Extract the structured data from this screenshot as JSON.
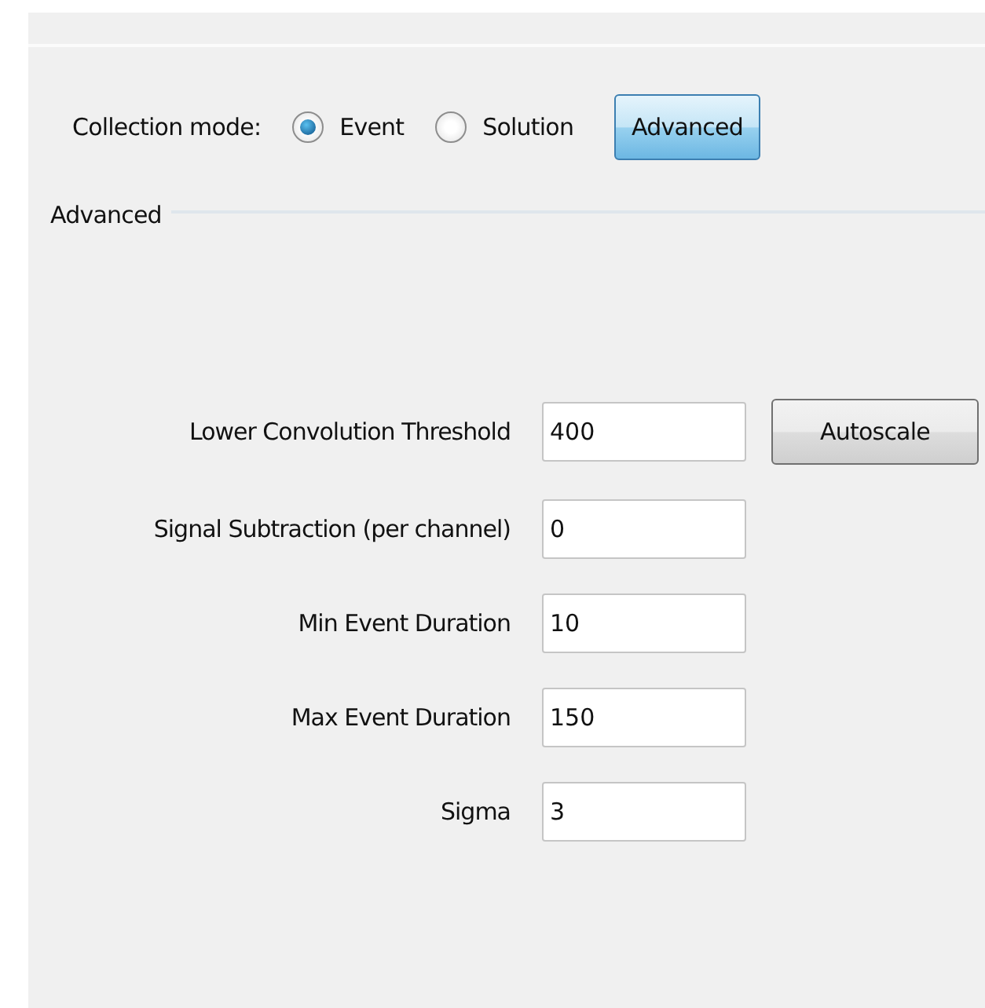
{
  "collection_mode": {
    "label": "Collection mode:",
    "options": [
      {
        "label": "Event",
        "selected": true
      },
      {
        "label": "Solution",
        "selected": false
      }
    ],
    "button": "Advanced"
  },
  "group": {
    "title": "Advanced"
  },
  "fields": [
    {
      "label": "Lower Convolution Threshold",
      "value": "400",
      "button": "Autoscale"
    },
    {
      "label": "Signal Subtraction (per channel)",
      "value": "0"
    },
    {
      "label": "Min Event Duration",
      "value": "10"
    },
    {
      "label": "Max Event Duration",
      "value": "150"
    },
    {
      "label": "Sigma",
      "value": "3"
    }
  ]
}
